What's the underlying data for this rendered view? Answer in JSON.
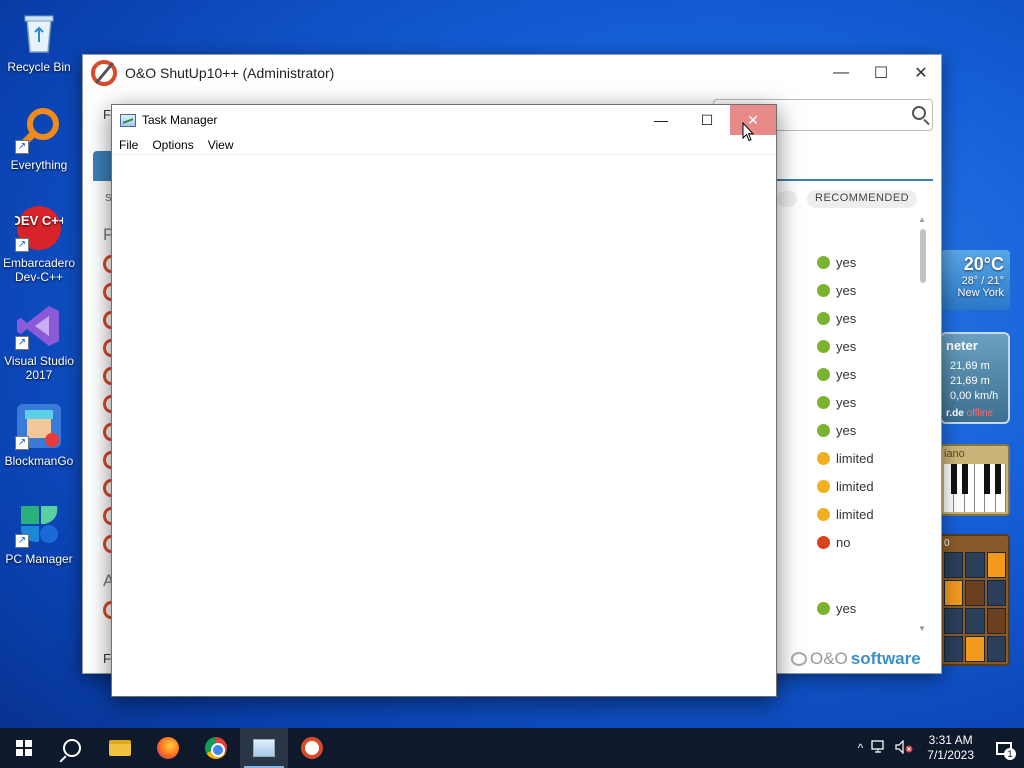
{
  "desktop": {
    "icons": [
      {
        "label": "Recycle Bin"
      },
      {
        "label": "Everything"
      },
      {
        "label": "Embarcadero Dev-C++"
      },
      {
        "label": "Visual Studio 2017"
      },
      {
        "label": "BlockmanGo"
      },
      {
        "label": "PC Manager"
      }
    ],
    "dev_icon_text": "DEV C++"
  },
  "gadgets": {
    "weather": {
      "temp": "20°C",
      "range": "28° / 21°",
      "city": "New York"
    },
    "meter": {
      "title": "neter",
      "values": [
        "21,69 m",
        "21,69 m",
        "0,00 km/h"
      ],
      "footer_site": "r.de",
      "footer_status": "offline"
    },
    "piano": {
      "label": "iano"
    },
    "puzzle": {
      "top": "0"
    }
  },
  "shutup": {
    "title": "O&O ShutUp10++ (Administrator)",
    "menu_fragment": "F",
    "col_fragment": "S",
    "section_letters": [
      "P",
      "A"
    ],
    "recommended_header": "RECOMMENDED",
    "recommendations": [
      {
        "label": "yes",
        "color": "#7cb32e"
      },
      {
        "label": "yes",
        "color": "#7cb32e"
      },
      {
        "label": "yes",
        "color": "#7cb32e"
      },
      {
        "label": "yes",
        "color": "#7cb32e"
      },
      {
        "label": "yes",
        "color": "#7cb32e"
      },
      {
        "label": "yes",
        "color": "#7cb32e"
      },
      {
        "label": "yes",
        "color": "#7cb32e"
      },
      {
        "label": "limited",
        "color": "#f2b01e"
      },
      {
        "label": "limited",
        "color": "#f2b01e"
      },
      {
        "label": "limited",
        "color": "#f2b01e"
      },
      {
        "label": "no",
        "color": "#d8431e"
      },
      {
        "label": "yes",
        "color": "#7cb32e"
      }
    ],
    "bottom_fragment": "Fi",
    "brand_left": "O&O",
    "brand_right": "software"
  },
  "taskmanager": {
    "title": "Task Manager",
    "menu": [
      "File",
      "Options",
      "View"
    ]
  },
  "taskbar": {
    "time": "3:31 AM",
    "date": "7/1/2023",
    "notification_count": "1",
    "tray_up": "^"
  }
}
